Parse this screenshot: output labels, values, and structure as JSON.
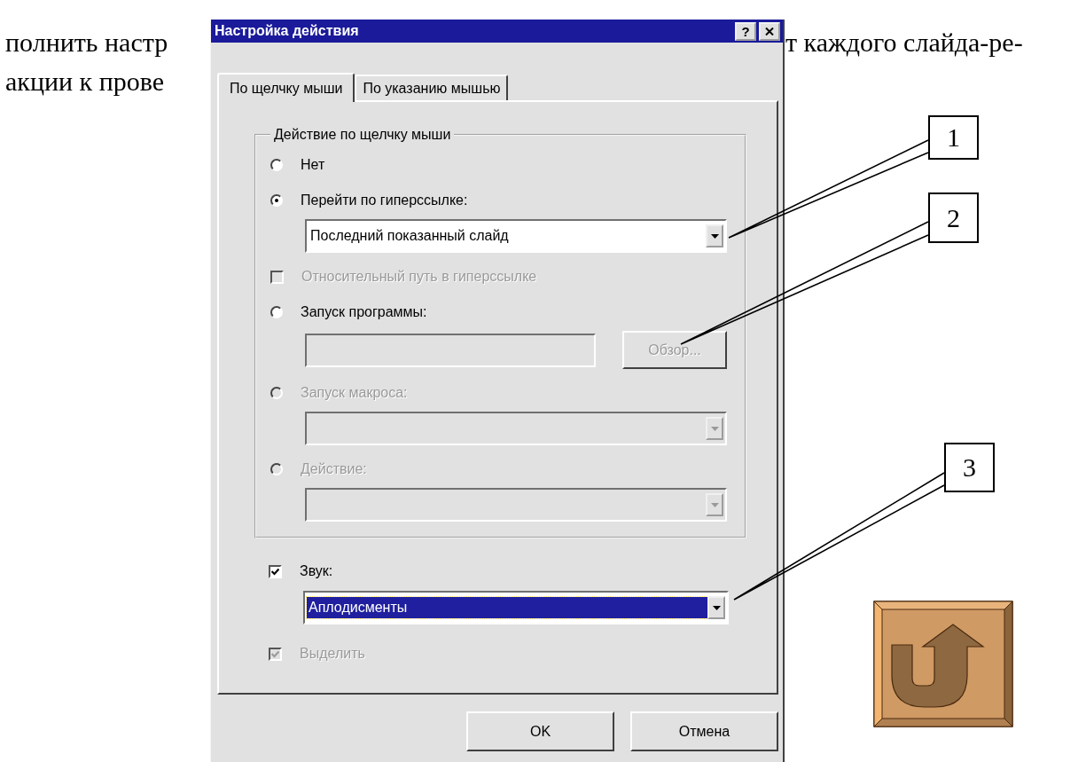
{
  "page_text": {
    "left_lines": [
      "полнить настр",
      "акции к прове"
    ],
    "right_lines": [
      "т каждого слайда-ре-"
    ]
  },
  "dialog": {
    "title": "Настройка действия",
    "help_button": "?",
    "tabs": [
      {
        "label": "По щелчку мыши",
        "selected": true
      },
      {
        "label": "По указанию мышью",
        "selected": false
      }
    ],
    "group": {
      "title": "Действие по щелчку мыши",
      "items": [
        {
          "kind": "radio",
          "label": "Нет",
          "selected": false,
          "disabled": false
        },
        {
          "kind": "radio",
          "label": "Перейти по гиперссылке:",
          "selected": true,
          "disabled": false
        },
        {
          "kind": "combo",
          "value": "Последний показанный слайд",
          "disabled": false
        },
        {
          "kind": "checkbox",
          "label": "Относительный путь в гиперссылке",
          "checked": false,
          "disabled": true
        },
        {
          "kind": "radio",
          "label": "Запуск программы:",
          "selected": false,
          "disabled": false
        },
        {
          "kind": "field_button",
          "button": "Обзор...",
          "disabled": true
        },
        {
          "kind": "radio",
          "label": "Запуск макроса:",
          "selected": false,
          "disabled": true
        },
        {
          "kind": "combo",
          "disabled": true
        },
        {
          "kind": "radio",
          "label": "Действие:",
          "selected": false,
          "disabled": true
        },
        {
          "kind": "combo",
          "disabled": true
        }
      ]
    },
    "items": [
      {
        "kind": "checkbox",
        "label": "Звук:",
        "checked": true,
        "disabled": false
      },
      {
        "kind": "combo",
        "value": "Аплодисменты",
        "disabled": false,
        "highlighted": true
      },
      {
        "kind": "checkbox",
        "label": "Выделить",
        "checked": true,
        "disabled": true
      }
    ],
    "buttons": [
      {
        "label": "OK"
      },
      {
        "label": "Отмена"
      }
    ]
  },
  "callouts": [
    {
      "label": "1"
    },
    {
      "label": "2"
    },
    {
      "label": "3"
    }
  ]
}
